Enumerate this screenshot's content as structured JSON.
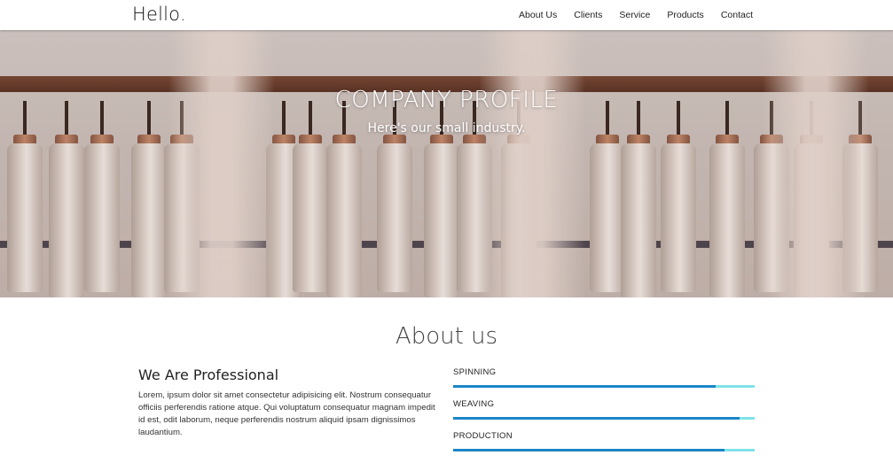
{
  "nav": {
    "brand": "Hello.",
    "items": [
      {
        "label": "About Us"
      },
      {
        "label": "Clients"
      },
      {
        "label": "Service"
      },
      {
        "label": "Products"
      },
      {
        "label": "Contact"
      }
    ]
  },
  "hero": {
    "title": "COMPANY PROFILE",
    "subtitle": "Here's our small industry."
  },
  "about": {
    "heading": "About us",
    "subheading": "We Are Professional",
    "body": "Lorem, ipsum dolor sit amet consectetur adipisicing elit. Nostrum consequatur officiis perferendis ratione atque. Qui voluptatum consequatur magnam impedit id est, odit laborum, neque perferendis nostrum aliquid ipsam dignissimos laudantium.",
    "skills": [
      {
        "label": "SPINNING",
        "percent": 87
      },
      {
        "label": "WEAVING",
        "percent": 95
      },
      {
        "label": "PRODUCTION",
        "percent": 90
      }
    ],
    "colors": {
      "bar_fill": "#1a86c8",
      "bar_track": "#7fe3e8"
    }
  }
}
